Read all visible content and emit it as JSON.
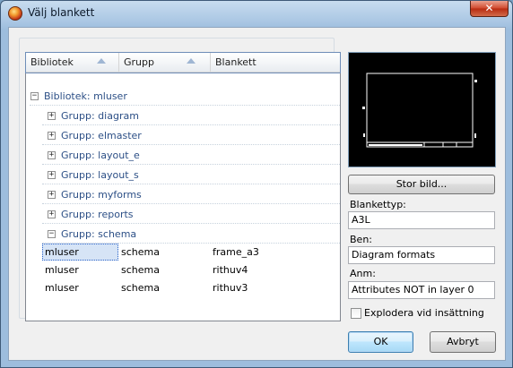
{
  "window": {
    "title": "Välj blankett",
    "close_glyph": "✕"
  },
  "list": {
    "columns": [
      "Bibliotek",
      "Grupp",
      "Blankett"
    ],
    "library": "Bibliotek: mluser",
    "groups": [
      "Grupp: diagram",
      "Grupp: elmaster",
      "Grupp: layout_e",
      "Grupp: layout_s",
      "Grupp: myforms",
      "Grupp: reports",
      "Grupp: schema"
    ],
    "rows": [
      {
        "bibliotek": "mluser",
        "grupp": "schema",
        "blankett": "frame_a3",
        "selected": true
      },
      {
        "bibliotek": "mluser",
        "grupp": "schema",
        "blankett": "rithuv4",
        "selected": false
      },
      {
        "bibliotek": "mluser",
        "grupp": "schema",
        "blankett": "rithuv3",
        "selected": false
      }
    ]
  },
  "right": {
    "big_image_button": "Stor bild...",
    "type_label": "Blankettyp:",
    "type_value": "A3L",
    "ben_label": "Ben:",
    "ben_value": "Diagram formats",
    "anm_label": "Anm:",
    "anm_value": "Attributes NOT in layer 0",
    "explode_label": "Explodera vid insättning",
    "explode_checked": false
  },
  "buttons": {
    "ok": "OK",
    "cancel": "Avbryt"
  },
  "icons": {
    "app": "app-logo-icon",
    "close": "close-icon",
    "expand": "plus-toggle-icon",
    "collapse": "minus-toggle-icon",
    "sort": "sort-ascending-icon"
  }
}
